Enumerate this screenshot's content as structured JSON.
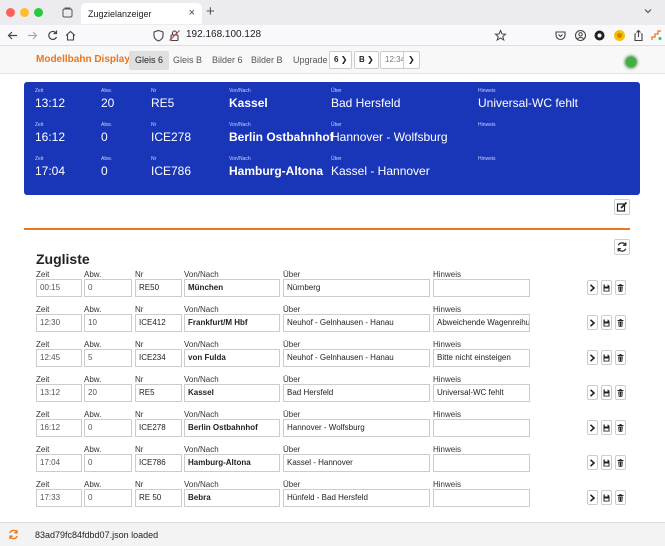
{
  "browser": {
    "tab_title": "Zugzielanzeiger",
    "url": "192.168.100.128",
    "dot_colors": [
      "#ff5f57",
      "#febc2e",
      "#28c840"
    ]
  },
  "app": {
    "brand": "Modellbahn Displays",
    "accent": "#e8761f",
    "nav_links": [
      "Gleis 6",
      "Gleis B",
      "Bilder 6",
      "Bilder B",
      "Upgrade"
    ],
    "active_link": "Gleis 6",
    "quick_buttons": [
      {
        "label": "6",
        "icon": "chevron-right-icon"
      },
      {
        "label": "B",
        "icon": "chevron-right-icon"
      }
    ],
    "time_button": {
      "label": "12:34",
      "icon": "chevron-right-icon"
    },
    "status_led_color": "#3fb03f"
  },
  "board": {
    "background": "#1a36b8",
    "labels": {
      "zeit": "Zeit",
      "abw": "Abw.",
      "nr": "Nr",
      "vonnach": "Von/Nach",
      "ueber": "Über",
      "hinweis": "Hinweis"
    },
    "rows": [
      {
        "zeit": "13:12",
        "abw": "20",
        "nr": "RE5",
        "vonnach": "Kassel",
        "ueber": "Bad Hersfeld",
        "hinweis": "Universal-WC fehlt"
      },
      {
        "zeit": "16:12",
        "abw": "0",
        "nr": "ICE278",
        "vonnach": "Berlin Ostbahnhof",
        "ueber": "Hannover - Wolfsburg",
        "hinweis": ""
      },
      {
        "zeit": "17:04",
        "abw": "0",
        "nr": "ICE786",
        "vonnach": "Hamburg-Altona",
        "ueber": "Kassel - Hannover",
        "hinweis": ""
      }
    ]
  },
  "list": {
    "title": "Zugliste",
    "labels": {
      "zeit": "Zeit",
      "abw": "Abw.",
      "nr": "Nr",
      "vonnach": "Von/Nach",
      "ueber": "Über",
      "hinweis": "Hinweis"
    },
    "actions": [
      "play-icon",
      "save-icon",
      "trash-icon"
    ],
    "rows": [
      {
        "zeit": "00:15",
        "abw": "0",
        "nr": "RE50",
        "vonnach": "München",
        "ueber": "Nürnberg",
        "hinweis": ""
      },
      {
        "zeit": "12:30",
        "abw": "10",
        "nr": "ICE412",
        "vonnach": "Frankfurt/M Hbf",
        "ueber": "Neuhof - Gelnhausen - Hanau",
        "hinweis": "Abweichende Wagenreihung"
      },
      {
        "zeit": "12:45",
        "abw": "5",
        "nr": "ICE234",
        "vonnach": "von Fulda",
        "ueber": "Neuhof - Gelnhausen - Hanau",
        "hinweis": "Bitte nicht einsteigen"
      },
      {
        "zeit": "13:12",
        "abw": "20",
        "nr": "RE5",
        "vonnach": "Kassel",
        "ueber": "Bad Hersfeld",
        "hinweis": "Universal-WC fehlt"
      },
      {
        "zeit": "16:12",
        "abw": "0",
        "nr": "ICE278",
        "vonnach": "Berlin Ostbahnhof",
        "ueber": "Hannover - Wolfsburg",
        "hinweis": ""
      },
      {
        "zeit": "17:04",
        "abw": "0",
        "nr": "ICE786",
        "vonnach": "Hamburg-Altona",
        "ueber": "Kassel - Hannover",
        "hinweis": ""
      },
      {
        "zeit": "17:33",
        "abw": "0",
        "nr": "RE 50",
        "vonnach": "Bebra",
        "ueber": "Hünfeld - Bad Hersfeld",
        "hinweis": ""
      }
    ]
  },
  "status": {
    "text": "83ad79fc84fdbd07.json loaded",
    "icon": "refresh-icon"
  }
}
